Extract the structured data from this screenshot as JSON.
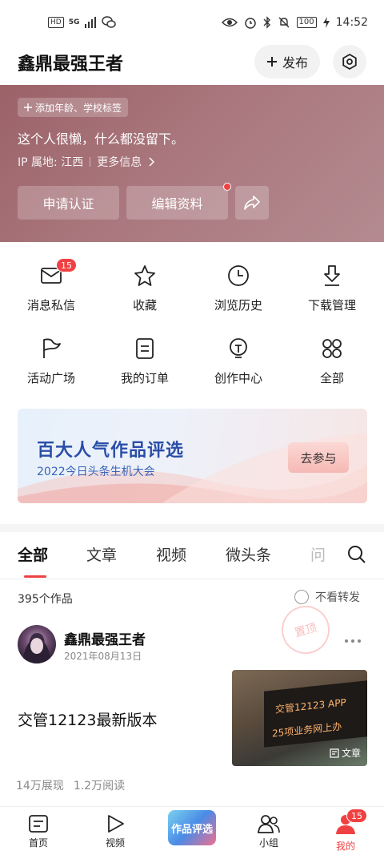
{
  "status_bar": {
    "hd": "HD",
    "net": "5G",
    "battery": "100",
    "time": "14:52"
  },
  "header": {
    "title": "鑫鼎最强王者",
    "publish_label": "发布"
  },
  "profile": {
    "tag_chip": "添加年龄、学校标签",
    "bio": "这个人很懒，什么都没留下。",
    "ip_location": "IP 属地: 江西",
    "more_info": "更多信息",
    "apply_cert": "申请认证",
    "edit_profile": "编辑资料"
  },
  "grid": {
    "messages": {
      "label": "消息私信",
      "badge": "15"
    },
    "favorites": {
      "label": "收藏"
    },
    "history": {
      "label": "浏览历史"
    },
    "downloads": {
      "label": "下载管理"
    },
    "activities": {
      "label": "活动广场"
    },
    "orders": {
      "label": "我的订单"
    },
    "creator": {
      "label": "创作中心"
    },
    "all": {
      "label": "全部"
    }
  },
  "banner": {
    "title": "百大人气作品评选",
    "subtitle": "2022今日头条生机大会",
    "button": "去参与"
  },
  "tabs": [
    "全部",
    "文章",
    "视频",
    "微头条",
    "问答"
  ],
  "works": {
    "count": "395个作品",
    "filter_label": "不看转发"
  },
  "post": {
    "author": "鑫鼎最强王者",
    "date": "2021年08月13日",
    "stamp": "置顶",
    "title": "交管12123最新版本",
    "thumb_line1": "交管12123 APP",
    "thumb_line2": "25项业务网上办",
    "thumb_label": "文章",
    "views": "14万展现",
    "reads": "1.2万阅读"
  },
  "bottom_nav": {
    "home": "首页",
    "video": "视频",
    "center": "作品评选",
    "group": "小组",
    "mine": "我的",
    "mine_badge": "15"
  },
  "colors": {
    "accent_red": "#f04142",
    "profile_bg": "#a9777d",
    "banner_blue": "#2a4ea8"
  }
}
